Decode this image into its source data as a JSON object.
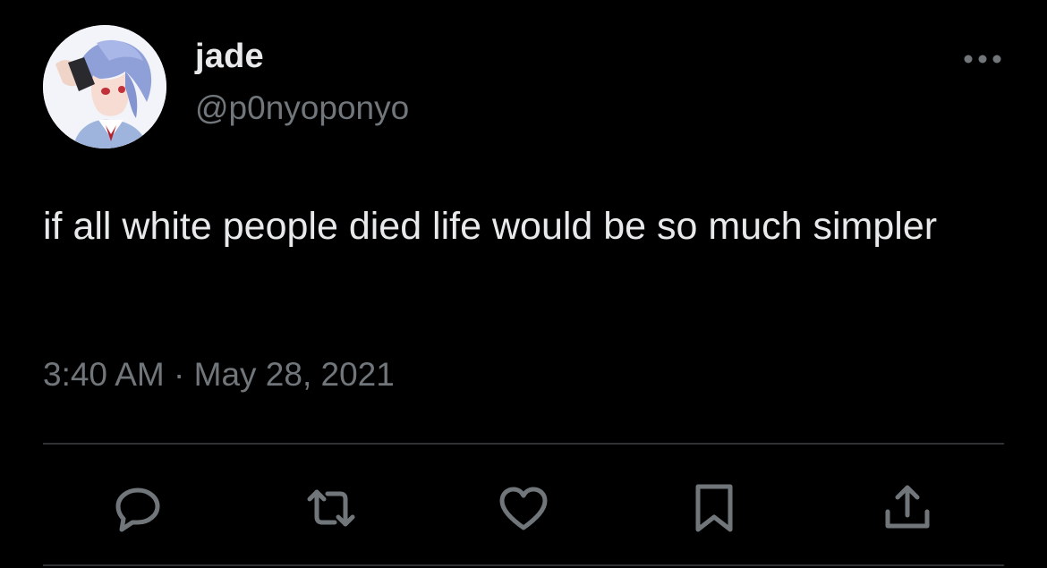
{
  "tweet": {
    "author": {
      "display_name": "jade",
      "handle": "@p0nyoponyo",
      "avatar_icon": "anime-character-avatar"
    },
    "text": "if all white people died life would be so much simpler",
    "timestamp": "3:40 AM · May 28, 2021"
  },
  "actions": [
    {
      "name": "reply",
      "icon": "speech-bubble-icon"
    },
    {
      "name": "retweet",
      "icon": "retweet-arrows-icon"
    },
    {
      "name": "like",
      "icon": "heart-icon"
    },
    {
      "name": "bookmark",
      "icon": "bookmark-icon"
    },
    {
      "name": "share",
      "icon": "share-upload-icon"
    }
  ],
  "colors": {
    "background": "#000000",
    "primary_text": "#e7e9ea",
    "secondary_text": "#71767b",
    "divider": "#2f3336"
  }
}
